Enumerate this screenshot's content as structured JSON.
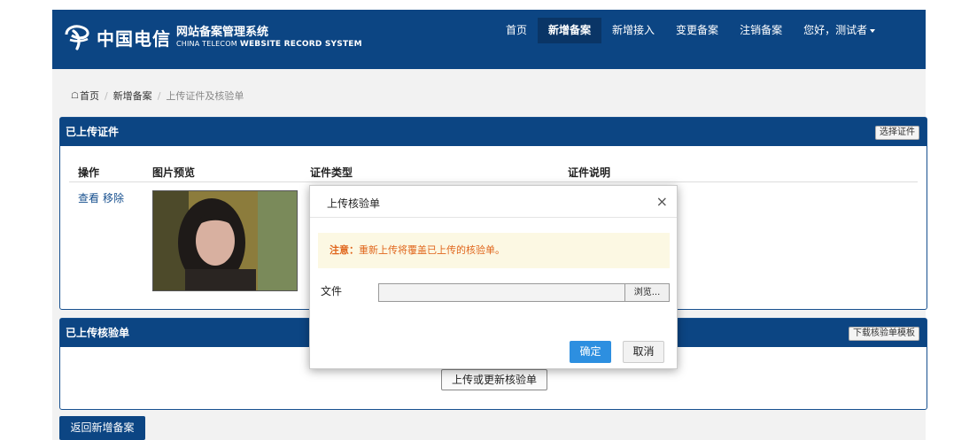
{
  "header": {
    "logo_cn": "中国电信",
    "logo_title": "网站备案管理系统",
    "logo_sub_brand": "CHINA TELECOM",
    "logo_sub_system": "WEBSITE RECORD SYSTEM",
    "nav": [
      "首页",
      "新增备案",
      "新增接入",
      "变更备案",
      "注销备案"
    ],
    "active_nav_index": 1,
    "user_greeting": "您好，测试者"
  },
  "breadcrumb": {
    "items": [
      "首页",
      "新增备案",
      "上传证件及核验单"
    ]
  },
  "certificates_panel": {
    "title": "已上传证件",
    "action": "选择证件",
    "columns": [
      "操作",
      "图片预览",
      "证件类型",
      "证件说明"
    ],
    "row_actions": [
      "查看",
      "移除"
    ]
  },
  "checklist_panel": {
    "title": "已上传核验单",
    "action": "下载核验单模板",
    "upload_button": "上传或更新核验单"
  },
  "back_button": "返回新增备案",
  "modal": {
    "title": "上传核验单",
    "close": "×",
    "notice_label": "注意：",
    "notice_text": "重新上传将覆盖已上传的核验单。",
    "file_label": "文件",
    "browse": "浏览...",
    "ok": "确定",
    "cancel": "取消"
  },
  "colors": {
    "brand_blue": "#0c4583",
    "primary_button": "#2d8fe0",
    "warning_text": "#e0661c",
    "warning_bg": "#fcf8e3"
  }
}
